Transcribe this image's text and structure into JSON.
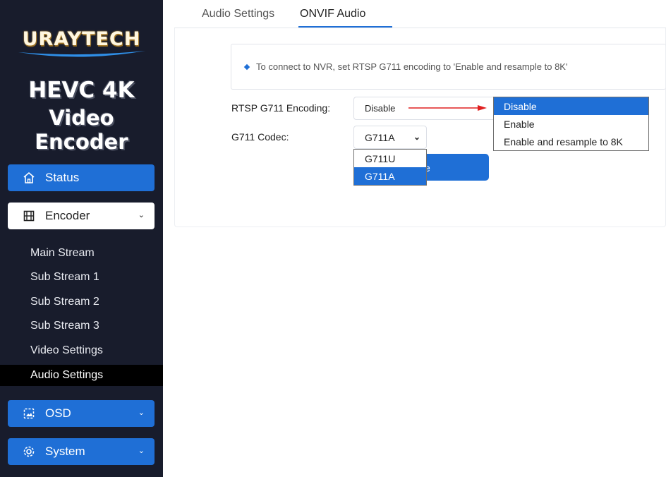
{
  "brand": {
    "logo_text": "URAYTECH",
    "product_line1": "HEVC 4K",
    "product_line2": "Video Encoder"
  },
  "sidebar": {
    "status": {
      "label": "Status",
      "icon": "home-icon"
    },
    "encoder": {
      "label": "Encoder",
      "icon": "film-icon"
    },
    "sub_items": [
      {
        "label": "Main Stream"
      },
      {
        "label": "Sub Stream 1"
      },
      {
        "label": "Sub Stream 2"
      },
      {
        "label": "Sub Stream 3"
      },
      {
        "label": "Video Settings"
      },
      {
        "label": "Audio Settings"
      }
    ],
    "osd": {
      "label": "OSD",
      "icon": "image-icon"
    },
    "system": {
      "label": "System",
      "icon": "gear-icon"
    }
  },
  "tabs": [
    {
      "label": "Audio Settings"
    },
    {
      "label": "ONVIF Audio"
    }
  ],
  "notice": "To connect to NVR, set RTSP G711 encoding to 'Enable and resample to 8K'",
  "form": {
    "rtsp_label": "RTSP G711 Encoding:",
    "rtsp_value": "Disable",
    "rtsp_options": [
      "Disable",
      "Enable",
      "Enable and resample to 8K"
    ],
    "codec_label": "G711 Codec:",
    "codec_value": "G711A",
    "codec_options": [
      "G711U",
      "G711A"
    ],
    "save_partial": "e"
  },
  "colors": {
    "accent": "#1f6fd6",
    "sidebar_bg": "#181c2c",
    "annotation_arrow": "#e02020"
  }
}
